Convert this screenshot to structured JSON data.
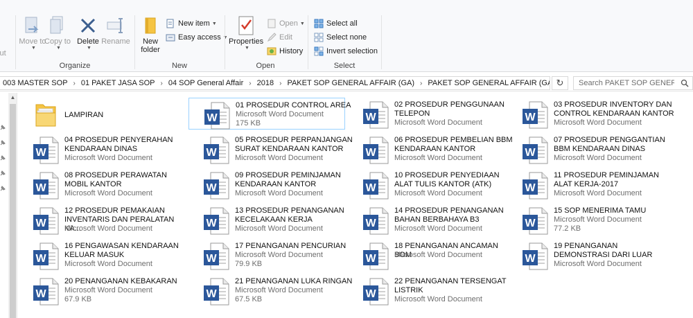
{
  "ribbon": {
    "cut_label": "cut",
    "organize": {
      "label": "Organize",
      "move_to": "Move to",
      "copy_to": "Copy to",
      "delete": "Delete",
      "rename": "Rename"
    },
    "new": {
      "label": "New",
      "new_folder": "New folder",
      "new_item": "New item",
      "easy_access": "Easy access"
    },
    "open": {
      "label": "Open",
      "properties": "Properties",
      "open": "Open",
      "edit": "Edit",
      "history": "History"
    },
    "select": {
      "label": "Select",
      "select_all": "Select all",
      "select_none": "Select none",
      "invert_selection": "Invert selection"
    }
  },
  "address": {
    "crumbs": [
      "003 MASTER SOP",
      "01 PAKET JASA SOP",
      "04 SOP General Affair",
      "2018",
      "PAKET SOP GENERAL AFFAIR (GA)",
      "PAKET SOP GENERAL AFFAIR (GA)"
    ],
    "search_placeholder": "Search PAKET SOP GENERAL ..."
  },
  "files": [
    {
      "name": "LAMPIRAN",
      "type": "",
      "size": "",
      "kind": "folder"
    },
    {
      "name": "01 PROSEDUR CONTROL AREA",
      "type": "Microsoft Word Document",
      "size": "175 KB",
      "kind": "word",
      "selected": true
    },
    {
      "name": "02 PROSEDUR PENGGUNAAN TELEPON",
      "type": "Microsoft Word Document",
      "size": "",
      "kind": "word"
    },
    {
      "name": "03 PROSEDUR INVENTORY  DAN CONTROL KENDARAAN KANTOR",
      "type": "Microsoft Word Document",
      "size": "",
      "kind": "word"
    },
    {
      "name": "04 PROSEDUR PENYERAHAN KENDARAAN DINAS",
      "type": "Microsoft Word Document",
      "size": "",
      "kind": "word"
    },
    {
      "name": "05 PROSEDUR PERPANJANGAN SURAT KENDARAAN KANTOR",
      "type": "Microsoft Word Document",
      "size": "",
      "kind": "word"
    },
    {
      "name": "06 PROSEDUR PEMBELIAN BBM KENDARAAN KANTOR",
      "type": "Microsoft Word Document",
      "size": "",
      "kind": "word"
    },
    {
      "name": "07 PROSEDUR PENGGANTIAN BBM KENDARAAN DINAS",
      "type": "Microsoft Word Document",
      "size": "",
      "kind": "word"
    },
    {
      "name": "08 PROSEDUR PERAWATAN MOBIL KANTOR",
      "type": "Microsoft Word Document",
      "size": "",
      "kind": "word"
    },
    {
      "name": "09 PROSEDUR PEMINJAMAN KENDARAAN KANTOR",
      "type": "Microsoft Word Document",
      "size": "",
      "kind": "word"
    },
    {
      "name": "10 PROSEDUR PENYEDIAAN  ALAT TULIS KANTOR (ATK)",
      "type": "Microsoft Word Document",
      "size": "",
      "kind": "word"
    },
    {
      "name": "11 PROSEDUR  PEMINJAMAN ALAT KERJA-2017",
      "type": "Microsoft Word Document",
      "size": "",
      "kind": "word"
    },
    {
      "name": "12 PROSEDUR PEMAKAIAN INVENTARIS DAN PERALATAN KA...",
      "type": "Microsoft Word Document",
      "size": "",
      "kind": "word"
    },
    {
      "name": "13 PROSEDUR PENANGANAN KECELAKAAN KERJA",
      "type": "Microsoft Word Document",
      "size": "",
      "kind": "word"
    },
    {
      "name": "14 PROSEDUR PENANGANAN BAHAN BERBAHAYA B3",
      "type": "Microsoft Word Document",
      "size": "",
      "kind": "word"
    },
    {
      "name": "15 SOP MENERIMA TAMU",
      "type": "Microsoft Word Document",
      "size": "77.2 KB",
      "kind": "word"
    },
    {
      "name": "16 PENGAWASAN KENDARAAN KELUAR MASUK",
      "type": "Microsoft Word Document",
      "size": "",
      "kind": "word"
    },
    {
      "name": "17 PENANGANAN PENCURIAN",
      "type": "Microsoft Word Document",
      "size": "79.9 KB",
      "kind": "word"
    },
    {
      "name": "18 PENANGANAN ANCAMAN BOM",
      "type": "Microsoft Word Document",
      "size": "",
      "kind": "word"
    },
    {
      "name": "19 PENANGANAN DEMONSTRASI DARI LUAR",
      "type": "Microsoft Word Document",
      "size": "",
      "kind": "word"
    },
    {
      "name": "20 PENANGANAN KEBAKARAN",
      "type": "Microsoft Word Document",
      "size": "67.9 KB",
      "kind": "word"
    },
    {
      "name": "21 PENANGANAN LUKA RINGAN",
      "type": "Microsoft Word Document",
      "size": "67.5 KB",
      "kind": "word"
    },
    {
      "name": "22 PENANGANAN TERSENGAT LISTRIK",
      "type": "Microsoft Word Document",
      "size": "",
      "kind": "word"
    }
  ],
  "colors": {
    "word_blue": "#2b579a",
    "selection_border": "#99d1ff",
    "folder_yellow": "#f5c443"
  }
}
